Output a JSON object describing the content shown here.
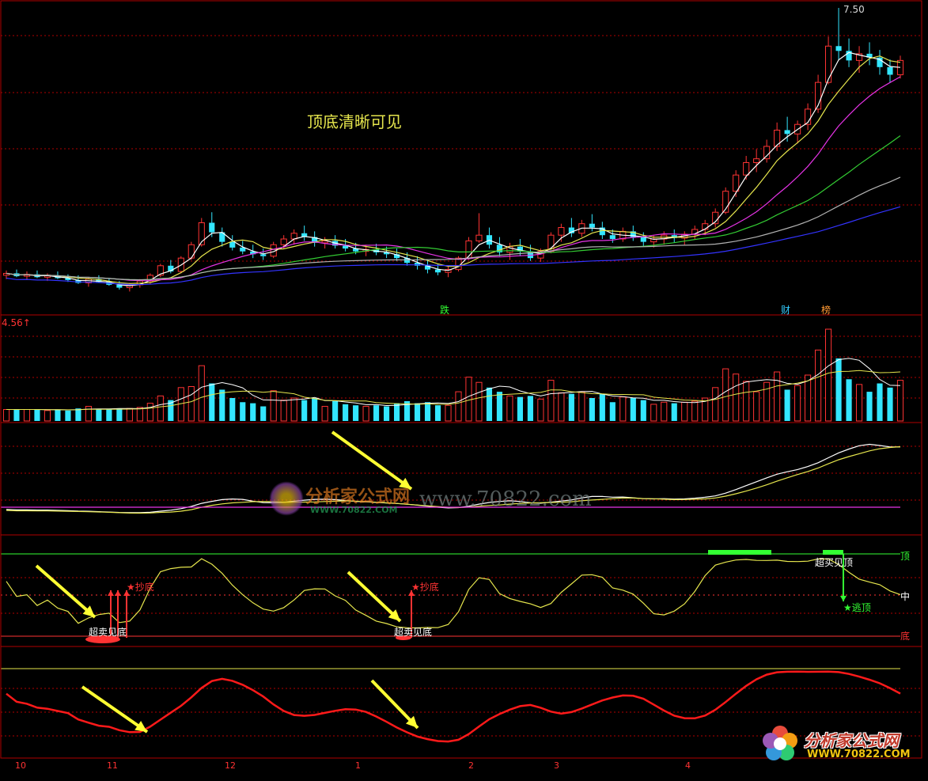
{
  "colors": {
    "background": "#000000",
    "frame": "#b00000",
    "grid": "#b00000",
    "up": "#ff3333",
    "down": "#33e6ff",
    "ma_white": "#ffffff",
    "ma_yellow": "#e6e64d",
    "ma_magenta": "#e633e6",
    "ma_green": "#33cc33",
    "ma_gray": "#b3b3b3",
    "ma_blue": "#3333ff",
    "osc_line": "#e6e64d",
    "top_line": "#33ff33",
    "bottom_line": "#ff3333",
    "red_curve": "#ff1a1a",
    "arrow_yellow": "#ffff33",
    "watermark_red": "#c0392b",
    "watermark_yellow": "#f1c40f"
  },
  "annotation_title": "顶底清晰可见",
  "price_panel": {
    "high_label": "7.50",
    "event_tags": [
      {
        "text": "跌",
        "color": "#33ff33"
      },
      {
        "text": "财",
        "color": "#33ccff"
      },
      {
        "text": "榜",
        "color": "#ff9933"
      }
    ]
  },
  "volume_panel": {
    "label": "4.56",
    "label_arrow": "↑"
  },
  "oscillator_panel": {
    "top_label": "顶",
    "mid_label": "中",
    "bottom_label": "底",
    "signals": [
      {
        "text": "超卖见底",
        "kind": "bottom"
      },
      {
        "text": "★抄底",
        "kind": "buy"
      },
      {
        "text": "超卖见底",
        "kind": "bottom"
      },
      {
        "text": "★抄底",
        "kind": "buy"
      },
      {
        "text": "超买见顶",
        "kind": "top"
      },
      {
        "text": "★逃顶",
        "kind": "sell"
      }
    ]
  },
  "x_axis": {
    "ticks": [
      "10",
      "11",
      "12",
      "1",
      "2",
      "3",
      "4"
    ]
  },
  "watermark": {
    "center_cn": "分析家公式网",
    "center_url": "www.70822.com",
    "center_small": "WWW.70822.COM",
    "corner_cn": "分析家公式网",
    "corner_url": "WWW.70822.COM"
  },
  "chart_data": {
    "type": "candlestick",
    "title": "",
    "high": 7.5,
    "series": [
      {
        "kind": "candles",
        "values": [
          [
            4.7,
            4.75,
            4.66,
            4.72
          ],
          [
            4.72,
            4.76,
            4.68,
            4.69
          ],
          [
            4.69,
            4.74,
            4.65,
            4.71
          ],
          [
            4.71,
            4.75,
            4.67,
            4.68
          ],
          [
            4.68,
            4.72,
            4.64,
            4.7
          ],
          [
            4.7,
            4.74,
            4.66,
            4.67
          ],
          [
            4.67,
            4.71,
            4.63,
            4.65
          ],
          [
            4.65,
            4.7,
            4.61,
            4.62
          ],
          [
            4.62,
            4.68,
            4.58,
            4.66
          ],
          [
            4.66,
            4.7,
            4.62,
            4.63
          ],
          [
            4.63,
            4.67,
            4.59,
            4.6
          ],
          [
            4.6,
            4.64,
            4.55,
            4.57
          ],
          [
            4.57,
            4.62,
            4.53,
            4.6
          ],
          [
            4.6,
            4.66,
            4.57,
            4.64
          ],
          [
            4.64,
            4.72,
            4.61,
            4.7
          ],
          [
            4.7,
            4.82,
            4.68,
            4.8
          ],
          [
            4.8,
            4.86,
            4.72,
            4.74
          ],
          [
            4.74,
            4.9,
            4.72,
            4.88
          ],
          [
            4.88,
            5.05,
            4.86,
            5.02
          ],
          [
            5.02,
            5.3,
            5.0,
            5.25
          ],
          [
            5.25,
            5.36,
            5.1,
            5.15
          ],
          [
            5.15,
            5.2,
            5.0,
            5.05
          ],
          [
            5.05,
            5.12,
            4.96,
            4.99
          ],
          [
            4.99,
            5.06,
            4.92,
            4.95
          ],
          [
            4.95,
            5.02,
            4.88,
            4.92
          ],
          [
            4.92,
            4.98,
            4.86,
            4.9
          ],
          [
            4.9,
            5.05,
            4.88,
            5.02
          ],
          [
            5.02,
            5.12,
            4.98,
            5.08
          ],
          [
            5.08,
            5.18,
            5.02,
            5.14
          ],
          [
            5.14,
            5.22,
            5.06,
            5.1
          ],
          [
            5.1,
            5.16,
            5.0,
            5.04
          ],
          [
            5.04,
            5.1,
            4.98,
            5.06
          ],
          [
            5.06,
            5.12,
            4.98,
            5.01
          ],
          [
            5.01,
            5.08,
            4.95,
            4.98
          ],
          [
            4.98,
            5.04,
            4.92,
            4.95
          ],
          [
            4.95,
            5.02,
            4.9,
            4.97
          ],
          [
            4.97,
            5.03,
            4.91,
            4.94
          ],
          [
            4.94,
            5.0,
            4.88,
            4.92
          ],
          [
            4.92,
            4.98,
            4.85,
            4.88
          ],
          [
            4.88,
            4.94,
            4.8,
            4.83
          ],
          [
            4.83,
            4.9,
            4.76,
            4.8
          ],
          [
            4.8,
            4.86,
            4.72,
            4.76
          ],
          [
            4.76,
            4.82,
            4.7,
            4.73
          ],
          [
            4.73,
            4.8,
            4.68,
            4.76
          ],
          [
            4.76,
            4.9,
            4.74,
            4.88
          ],
          [
            4.88,
            5.1,
            4.86,
            5.06
          ],
          [
            5.06,
            5.35,
            5.04,
            5.12
          ],
          [
            5.12,
            5.2,
            4.98,
            5.02
          ],
          [
            5.02,
            5.1,
            4.9,
            4.94
          ],
          [
            4.94,
            5.04,
            4.86,
            5.0
          ],
          [
            5.0,
            5.08,
            4.9,
            4.95
          ],
          [
            4.95,
            5.02,
            4.85,
            4.88
          ],
          [
            4.88,
            4.98,
            4.84,
            4.95
          ],
          [
            4.95,
            5.15,
            4.93,
            5.12
          ],
          [
            5.12,
            5.24,
            5.05,
            5.2
          ],
          [
            5.2,
            5.3,
            5.1,
            5.14
          ],
          [
            5.14,
            5.28,
            5.1,
            5.24
          ],
          [
            5.24,
            5.34,
            5.16,
            5.2
          ],
          [
            5.2,
            5.26,
            5.08,
            5.12
          ],
          [
            5.12,
            5.18,
            5.04,
            5.08
          ],
          [
            5.08,
            5.2,
            5.05,
            5.16
          ],
          [
            5.16,
            5.22,
            5.06,
            5.1
          ],
          [
            5.1,
            5.15,
            5.0,
            5.05
          ],
          [
            5.05,
            5.12,
            4.99,
            5.08
          ],
          [
            5.08,
            5.16,
            5.02,
            5.12
          ],
          [
            5.12,
            5.18,
            5.04,
            5.09
          ],
          [
            5.09,
            5.16,
            5.02,
            5.13
          ],
          [
            5.13,
            5.22,
            5.08,
            5.18
          ],
          [
            5.18,
            5.28,
            5.12,
            5.24
          ],
          [
            5.24,
            5.4,
            5.2,
            5.36
          ],
          [
            5.36,
            5.62,
            5.34,
            5.58
          ],
          [
            5.58,
            5.8,
            5.52,
            5.75
          ],
          [
            5.75,
            5.95,
            5.7,
            5.88
          ],
          [
            5.88,
            6.02,
            5.78,
            5.92
          ],
          [
            5.92,
            6.12,
            5.88,
            6.05
          ],
          [
            6.05,
            6.3,
            6.0,
            6.22
          ],
          [
            6.22,
            6.36,
            6.1,
            6.18
          ],
          [
            6.18,
            6.32,
            6.08,
            6.28
          ],
          [
            6.28,
            6.5,
            6.22,
            6.44
          ],
          [
            6.44,
            6.8,
            6.4,
            6.72
          ],
          [
            6.72,
            7.2,
            6.7,
            7.1
          ],
          [
            7.1,
            7.5,
            6.95,
            7.05
          ],
          [
            7.05,
            7.18,
            6.88,
            6.95
          ],
          [
            6.95,
            7.1,
            6.82,
            7.02
          ],
          [
            7.02,
            7.14,
            6.9,
            6.98
          ],
          [
            6.98,
            7.06,
            6.8,
            6.88
          ],
          [
            6.88,
            6.96,
            6.72,
            6.8
          ],
          [
            6.8,
            7.0,
            6.76,
            6.95
          ]
        ]
      },
      {
        "name": "",
        "kind": "ma",
        "values": []
      }
    ]
  }
}
